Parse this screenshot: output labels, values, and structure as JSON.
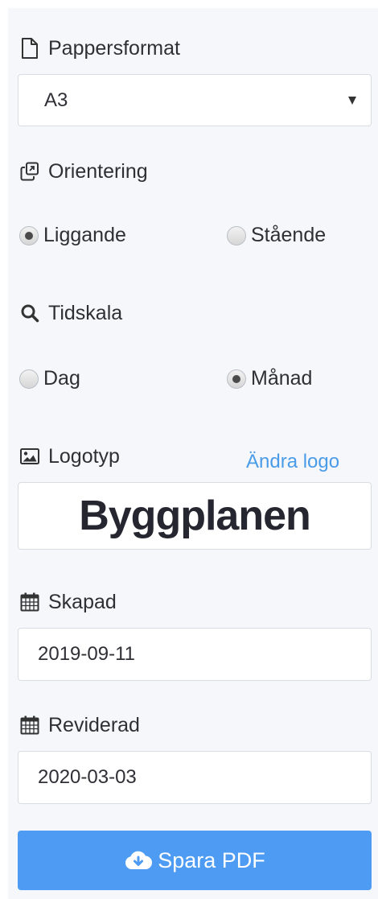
{
  "paper_format": {
    "label": "Pappersformat",
    "icon": "file-icon",
    "selected": "A3"
  },
  "orientation": {
    "label": "Orientering",
    "icon": "copy-icon",
    "options": [
      {
        "label": "Liggande",
        "checked": true
      },
      {
        "label": "Stående",
        "checked": false
      }
    ]
  },
  "timescale": {
    "label": "Tidskala",
    "icon": "search-icon",
    "options": [
      {
        "label": "Dag",
        "checked": false
      },
      {
        "label": "Månad",
        "checked": true
      }
    ]
  },
  "logo": {
    "label": "Logotyp",
    "icon": "image-icon",
    "change_link": "Ändra logo",
    "logo_text": "Byggplanen"
  },
  "created": {
    "label": "Skapad",
    "icon": "calendar-icon",
    "value": "2019-09-11"
  },
  "revised": {
    "label": "Reviderad",
    "icon": "calendar-icon",
    "value": "2020-03-03"
  },
  "save_button": {
    "label": "Spara PDF",
    "icon": "cloud-download-icon"
  },
  "colors": {
    "accent": "#4d9bf2",
    "link": "#4a9be8",
    "panel_bg": "#f5f7fa"
  }
}
